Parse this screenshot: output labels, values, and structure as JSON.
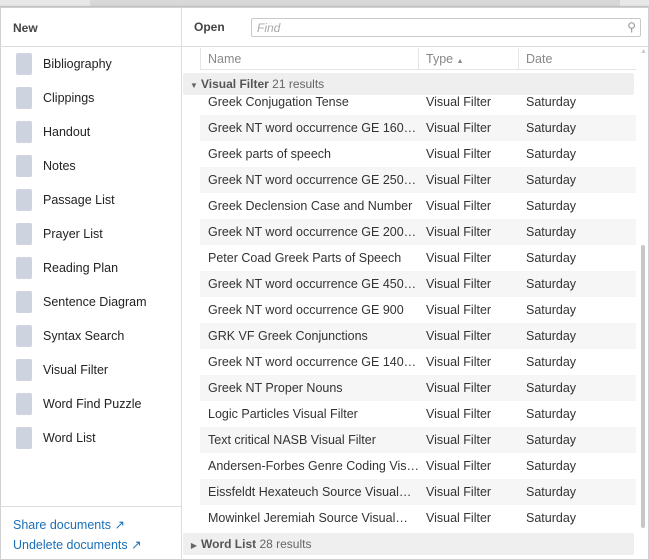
{
  "left": {
    "title": "New",
    "items": [
      {
        "label": "Bibliography",
        "icon": "person-icon"
      },
      {
        "label": "Clippings",
        "icon": "paperclip-icon"
      },
      {
        "label": "Handout",
        "icon": "handout-icon"
      },
      {
        "label": "Notes",
        "icon": "notebook-icon"
      },
      {
        "label": "Passage List",
        "icon": "bookmark-icon"
      },
      {
        "label": "Prayer List",
        "icon": "flame-icon"
      },
      {
        "label": "Reading Plan",
        "icon": "calendar-icon"
      },
      {
        "label": "Sentence Diagram",
        "icon": "diagram-icon"
      },
      {
        "label": "Syntax Search",
        "icon": "syntax-icon"
      },
      {
        "label": "Visual Filter",
        "icon": "filter-icon"
      },
      {
        "label": "Word Find Puzzle",
        "icon": "puzzle-icon"
      },
      {
        "label": "Word List",
        "icon": "list-icon"
      }
    ],
    "links": [
      "Share documents",
      "Undelete documents"
    ]
  },
  "right": {
    "title": "Open",
    "find_placeholder": "Find",
    "columns": [
      "Name",
      "Type",
      "Date"
    ],
    "sort_indicator": "▲",
    "groups": [
      {
        "name": "Visual Filter",
        "count": "21 results",
        "expanded": true
      },
      {
        "name": "Word List",
        "count": "28 results",
        "expanded": false
      }
    ],
    "rows": [
      [
        "Greek Conjugation Tense",
        "Visual Filter",
        "Saturday"
      ],
      [
        "Greek NT word occurrence GE 160…",
        "Visual Filter",
        "Saturday"
      ],
      [
        "Greek parts of speech",
        "Visual Filter",
        "Saturday"
      ],
      [
        "Greek NT word occurrence GE 250…",
        "Visual Filter",
        "Saturday"
      ],
      [
        "Greek Declension Case and Number",
        "Visual Filter",
        "Saturday"
      ],
      [
        "Greek NT word occurrence GE 200…",
        "Visual Filter",
        "Saturday"
      ],
      [
        "Peter Coad Greek Parts of Speech",
        "Visual Filter",
        "Saturday"
      ],
      [
        "Greek NT word occurrence GE 450…",
        "Visual Filter",
        "Saturday"
      ],
      [
        "Greek NT word occurrence GE 900",
        "Visual Filter",
        "Saturday"
      ],
      [
        "GRK VF Greek Conjunctions",
        "Visual Filter",
        "Saturday"
      ],
      [
        "Greek NT word occurrence GE 140…",
        "Visual Filter",
        "Saturday"
      ],
      [
        "Greek NT Proper Nouns",
        "Visual Filter",
        "Saturday"
      ],
      [
        "Logic Particles Visual Filter",
        "Visual Filter",
        "Saturday"
      ],
      [
        "Text critical NASB Visual Filter",
        "Visual Filter",
        "Saturday"
      ],
      [
        "Andersen-Forbes Genre Coding Vis…",
        "Visual Filter",
        "Saturday"
      ],
      [
        "Eissfeldt Hexateuch Source Visual…",
        "Visual Filter",
        "Saturday"
      ],
      [
        "Mowinkel Jeremiah Source Visual…",
        "Visual Filter",
        "Saturday"
      ]
    ]
  }
}
